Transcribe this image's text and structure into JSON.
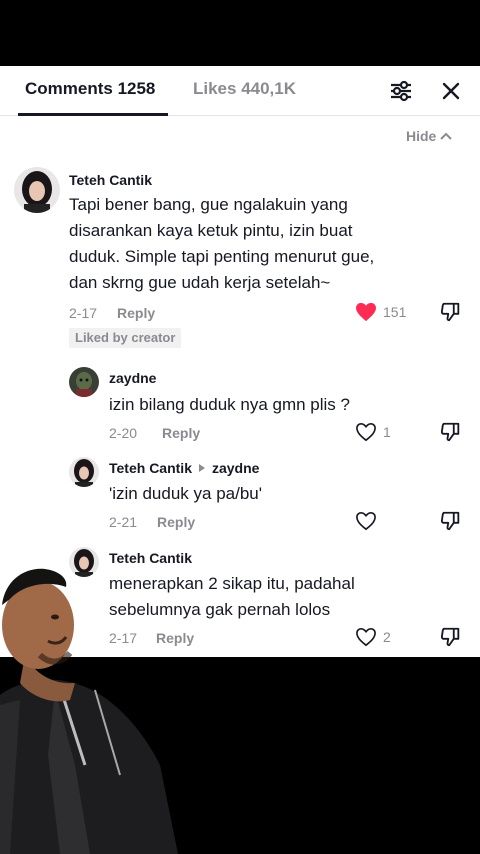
{
  "tabs": {
    "comments": "Comments 1258",
    "likes": "Likes 440,1K"
  },
  "hide_label": "Hide",
  "comments": [
    {
      "author": "Teteh Cantik",
      "lines": [
        "Tapi bener bang, gue ngalakuin yang",
        "disarankan kaya ketuk pintu, izin buat",
        "duduk. Simple tapi penting menurut gue,",
        "dan skrng gue udah kerja setelah~"
      ],
      "date": "2-17",
      "reply": "Reply",
      "likes": "151",
      "liked": true,
      "badge": "Liked by creator"
    }
  ],
  "replies": [
    {
      "author": "zaydne",
      "reply_to": "",
      "lines": [
        "izin bilang duduk nya gmn plis ?"
      ],
      "date": "2-20",
      "reply": "Reply",
      "likes": "1"
    },
    {
      "author": "Teteh Cantik",
      "reply_to": "zaydne",
      "lines": [
        "'izin duduk ya pa/bu'"
      ],
      "date": "2-21",
      "reply": "Reply",
      "likes": ""
    },
    {
      "author": "Teteh Cantik",
      "reply_to": "",
      "lines": [
        "menerapkan 2 sikap itu, padahal",
        "sebelumnya gak pernah lolos"
      ],
      "date": "2-17",
      "reply": "Reply",
      "likes": "2"
    }
  ],
  "colors": {
    "like_red": "#fe2c55",
    "text": "#161823",
    "muted": "#8a8b91"
  }
}
